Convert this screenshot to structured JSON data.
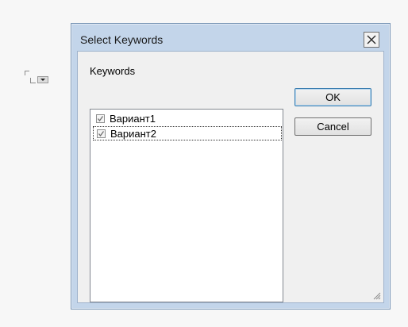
{
  "dialog": {
    "title": "Select Keywords",
    "keywords_label": "Keywords",
    "items": [
      {
        "label": "Вариант1",
        "checked": true
      },
      {
        "label": "Вариант2",
        "checked": true
      }
    ],
    "ok_label": "OK",
    "cancel_label": "Cancel"
  },
  "colors": {
    "frame": "#c3d5ea",
    "client": "#f0f0f0",
    "listbox": "#ffffff"
  },
  "icons": [
    "close-icon",
    "check-icon",
    "resize-grip-icon",
    "dropdown-arrow-icon"
  ]
}
